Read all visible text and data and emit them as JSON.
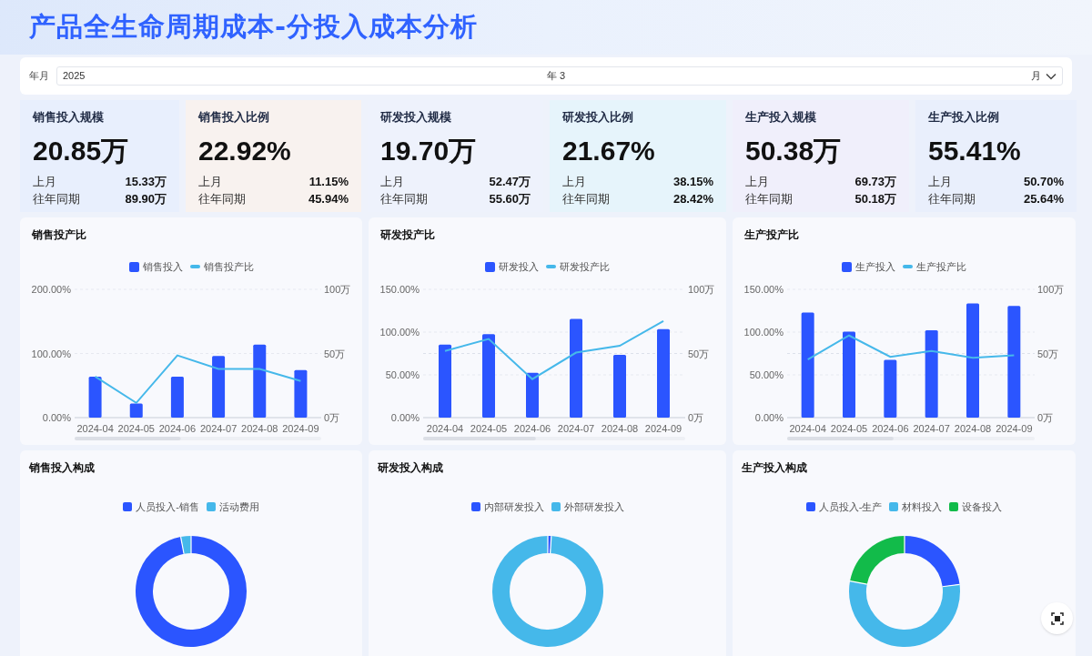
{
  "title": "产品全生命周期成本-分投入成本分析",
  "filter": {
    "label": "年月",
    "year": "2025",
    "year_unit": "年",
    "month": "3",
    "month_unit": "月"
  },
  "kpis": [
    {
      "title": "销售投入规模",
      "value": "20.85万",
      "rows": [
        {
          "label": "上月",
          "value": "15.33万"
        },
        {
          "label": "往年同期",
          "value": "89.90万"
        }
      ]
    },
    {
      "title": "销售投入比例",
      "value": "22.92%",
      "rows": [
        {
          "label": "上月",
          "value": "11.15%"
        },
        {
          "label": "往年同期",
          "value": "45.94%"
        }
      ]
    },
    {
      "title": "研发投入规模",
      "value": "19.70万",
      "rows": [
        {
          "label": "上月",
          "value": "52.47万"
        },
        {
          "label": "往年同期",
          "value": "55.60万"
        }
      ]
    },
    {
      "title": "研发投入比例",
      "value": "21.67%",
      "rows": [
        {
          "label": "上月",
          "value": "38.15%"
        },
        {
          "label": "往年同期",
          "value": "28.42%"
        }
      ]
    },
    {
      "title": "生产投入规模",
      "value": "50.38万",
      "rows": [
        {
          "label": "上月",
          "value": "69.73万"
        },
        {
          "label": "往年同期",
          "value": "50.18万"
        }
      ]
    },
    {
      "title": "生产投入比例",
      "value": "55.41%",
      "rows": [
        {
          "label": "上月",
          "value": "50.70%"
        },
        {
          "label": "往年同期",
          "value": "25.64%"
        }
      ]
    }
  ],
  "ratio_charts": [
    {
      "title": "销售投产比",
      "chart_data": {
        "type": "bar",
        "categories": [
          "2024-04",
          "2024-05",
          "2024-06",
          "2024-07",
          "2024-08",
          "2024-09"
        ],
        "ylim": [
          0,
          200
        ],
        "yticks": [
          {
            "value": 0,
            "label": "0.00%"
          },
          {
            "value": 100,
            "label": "100.00%"
          },
          {
            "value": 200,
            "label": "200.00%"
          }
        ],
        "y2lim": [
          0,
          100
        ],
        "y2ticks": [
          {
            "value": 0,
            "label": "0万"
          },
          {
            "value": 50,
            "label": "50万"
          },
          {
            "value": 100,
            "label": "100万"
          }
        ],
        "series": [
          {
            "name": "销售投入",
            "color": "#2b55ff",
            "type": "bar",
            "axis": "y2",
            "values": [
              32,
              11,
              32,
              48,
              57,
              37
            ]
          },
          {
            "name": "销售投产比",
            "color": "#45b8ea",
            "type": "line",
            "values": [
              64,
              23,
              97,
              76,
              76,
              57
            ]
          }
        ]
      }
    },
    {
      "title": "研发投产比",
      "chart_data": {
        "type": "bar",
        "categories": [
          "2024-04",
          "2024-05",
          "2024-06",
          "2024-07",
          "2024-08",
          "2024-09"
        ],
        "ylim": [
          0,
          150
        ],
        "yticks": [
          {
            "value": 0,
            "label": "0.00%"
          },
          {
            "value": 50,
            "label": "50.00%"
          },
          {
            "value": 100,
            "label": "100.00%"
          },
          {
            "value": 150,
            "label": "150.00%"
          }
        ],
        "y2lim": [
          0,
          100
        ],
        "y2ticks": [
          {
            "value": 0,
            "label": "0万"
          },
          {
            "value": 50,
            "label": "50万"
          },
          {
            "value": 100,
            "label": "100万"
          }
        ],
        "ref_lines": [
          {
            "value": 50,
            "axis": "y2"
          }
        ],
        "series": [
          {
            "name": "研发投入",
            "color": "#2b55ff",
            "type": "bar",
            "axis": "y2",
            "values": [
              57,
              65,
              35,
              77,
              49,
              69
            ]
          },
          {
            "name": "研发投产比",
            "color": "#45b8ea",
            "type": "line",
            "values": [
              78,
              92,
              45,
              76,
              84,
              113
            ]
          }
        ]
      }
    },
    {
      "title": "生产投产比",
      "chart_data": {
        "type": "bar",
        "categories": [
          "2024-04",
          "2024-05",
          "2024-06",
          "2024-07",
          "2024-08",
          "2024-09"
        ],
        "ylim": [
          0,
          150
        ],
        "yticks": [
          {
            "value": 0,
            "label": "0.00%"
          },
          {
            "value": 50,
            "label": "50.00%"
          },
          {
            "value": 100,
            "label": "100.00%"
          },
          {
            "value": 150,
            "label": "150.00%"
          }
        ],
        "y2lim": [
          0,
          100
        ],
        "y2ticks": [
          {
            "value": 0,
            "label": "0万"
          },
          {
            "value": 50,
            "label": "50万"
          },
          {
            "value": 100,
            "label": "100万"
          }
        ],
        "ref_lines": [
          {
            "value": 50,
            "axis": "y2"
          }
        ],
        "series": [
          {
            "name": "生产投入",
            "color": "#2b55ff",
            "type": "bar",
            "axis": "y2",
            "values": [
              82,
              67,
              45,
              68,
              89,
              87
            ]
          },
          {
            "name": "生产投产比",
            "color": "#45b8ea",
            "type": "line",
            "values": [
              68,
              96,
              71,
              78,
              70,
              73
            ]
          }
        ]
      }
    }
  ],
  "composition_charts": [
    {
      "title": "销售投入构成",
      "legend": [
        {
          "label": "人员投入-销售",
          "color": "#2b55ff"
        },
        {
          "label": "活动费用",
          "color": "#45b8ea"
        }
      ]
    },
    {
      "title": "研发投入构成",
      "legend": [
        {
          "label": "内部研发投入",
          "color": "#2b55ff"
        },
        {
          "label": "外部研发投入",
          "color": "#45b8ea"
        }
      ]
    },
    {
      "title": "生产投入构成",
      "legend": [
        {
          "label": "人员投入-生产",
          "color": "#2b55ff"
        },
        {
          "label": "材料投入",
          "color": "#45b8ea"
        },
        {
          "label": "设备投入",
          "color": "#12bb4a"
        }
      ]
    }
  ]
}
